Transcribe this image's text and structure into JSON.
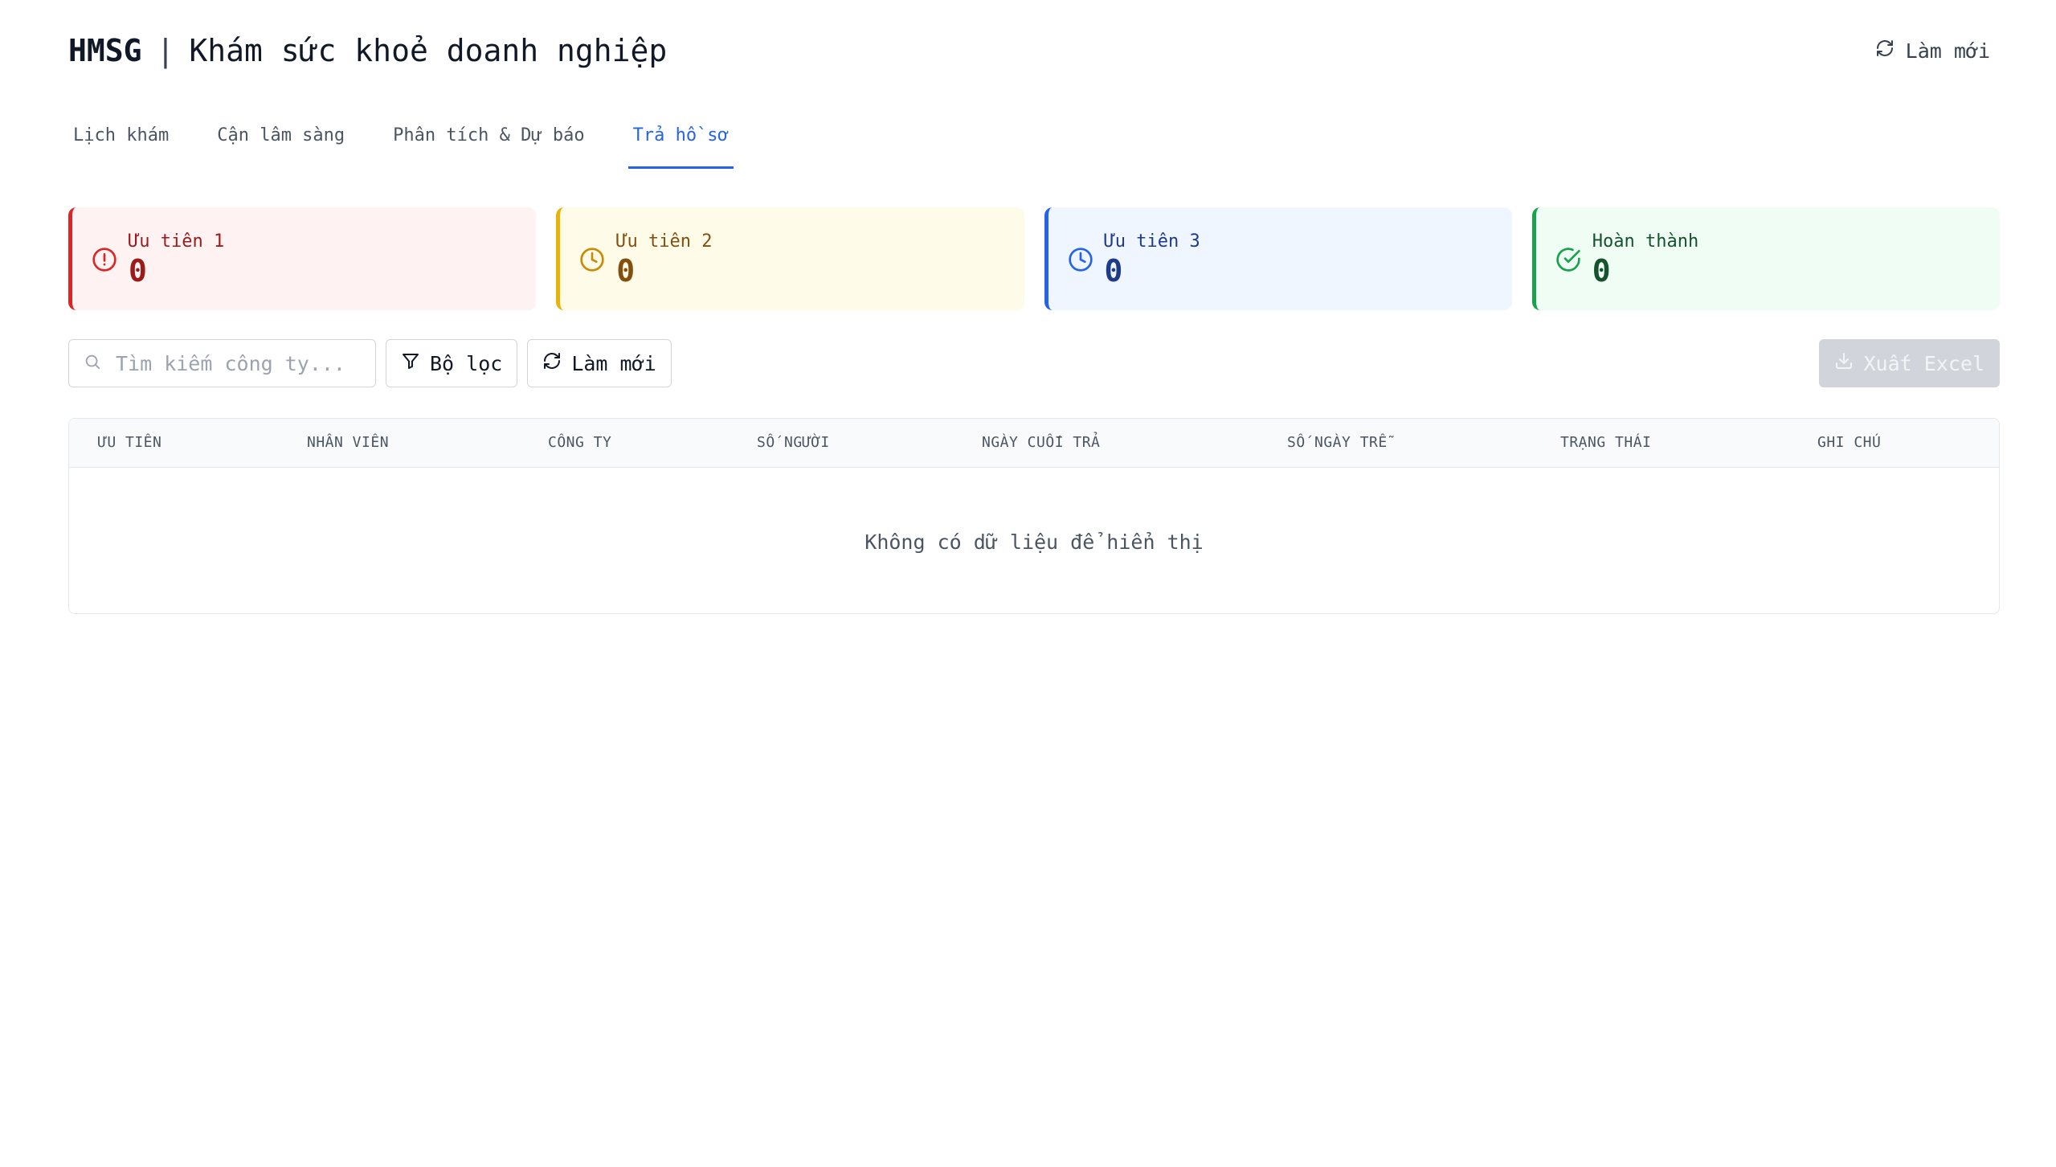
{
  "header": {
    "brand": "HMSG",
    "separator": "|",
    "title": "Khám sức khoẻ doanh nghiệp",
    "refresh_label": "Làm mới"
  },
  "tabs": [
    {
      "label": "Lịch khám",
      "active": false
    },
    {
      "label": "Cận lâm sàng",
      "active": false
    },
    {
      "label": "Phân tích & Dự báo",
      "active": false
    },
    {
      "label": "Trả hồ sơ",
      "active": true
    }
  ],
  "cards": [
    {
      "label": "Ưu tiên 1",
      "value": "0",
      "icon": "alert-circle-icon",
      "color": "#dc2626"
    },
    {
      "label": "Ưu tiên 2",
      "value": "0",
      "icon": "clock-icon",
      "color": "#eab308"
    },
    {
      "label": "Ưu tiên 3",
      "value": "0",
      "icon": "clock-icon",
      "color": "#2563eb"
    },
    {
      "label": "Hoàn thành",
      "value": "0",
      "icon": "check-circle-icon",
      "color": "#16a34a"
    }
  ],
  "toolbar": {
    "search_placeholder": "Tìm kiếm công ty...",
    "search_value": "",
    "filter_label": "Bộ lọc",
    "refresh_label": "Làm mới",
    "export_label": "Xuất Excel"
  },
  "table": {
    "columns": [
      "Ưu tiên",
      "Nhân viên",
      "Công ty",
      "Số người",
      "Ngày cuối trả",
      "Số ngày trễ",
      "Trạng thái",
      "Ghi chú"
    ],
    "rows": [],
    "empty_message": "Không có dữ liệu để hiển thị"
  },
  "colors": {
    "accent": "#2563eb"
  }
}
